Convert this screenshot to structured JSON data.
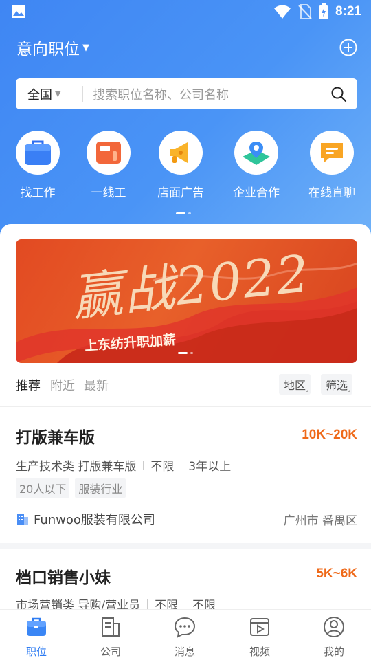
{
  "status_bar": {
    "time": "8:21",
    "icons": [
      "gallery-icon",
      "wifi-icon",
      "no-sim-icon",
      "battery-charging-icon"
    ]
  },
  "header": {
    "title": "意向职位",
    "add_icon": "plus-circle-icon"
  },
  "search": {
    "region": "全国",
    "placeholder": "搜索职位名称、公司名称"
  },
  "quick_nav": [
    {
      "label": "找工作",
      "icon": "briefcase-icon"
    },
    {
      "label": "一线工",
      "icon": "sewing-machine-icon"
    },
    {
      "label": "店面广告",
      "icon": "megaphone-icon"
    },
    {
      "label": "企业合作",
      "icon": "location-map-icon"
    },
    {
      "label": "在线直聊",
      "icon": "chat-bubble-icon"
    }
  ],
  "banner": {
    "headline": "赢战2022",
    "subtitle": "上东纺升职加薪"
  },
  "filter": {
    "tabs": [
      "推荐",
      "附近",
      "最新"
    ],
    "active_tab": "推荐",
    "chips": [
      "地区",
      "筛选"
    ]
  },
  "jobs": [
    {
      "title": "打版兼车版",
      "salary": "10K~20K",
      "meta": [
        "生产技术类 打版兼车版",
        "不限",
        "3年以上"
      ],
      "tags": [
        "20人以下",
        "服装行业"
      ],
      "company": "Funwoo服装有限公司",
      "location": "广州市 番禺区"
    },
    {
      "title": "档口销售小妹",
      "salary": "5K~6K",
      "meta": [
        "市场营销类 导购/营业员",
        "不限",
        "不限"
      ]
    }
  ],
  "bottom_nav": [
    {
      "label": "职位",
      "icon": "briefcase-icon",
      "active": true
    },
    {
      "label": "公司",
      "icon": "building-icon",
      "active": false
    },
    {
      "label": "消息",
      "icon": "message-icon",
      "active": false
    },
    {
      "label": "视频",
      "icon": "video-icon",
      "active": false
    },
    {
      "label": "我的",
      "icon": "profile-icon",
      "active": false
    }
  ],
  "colors": {
    "primary_blue": "#3f86f3",
    "salary_orange": "#ef6a1a",
    "active_nav": "#2f7cf2"
  }
}
